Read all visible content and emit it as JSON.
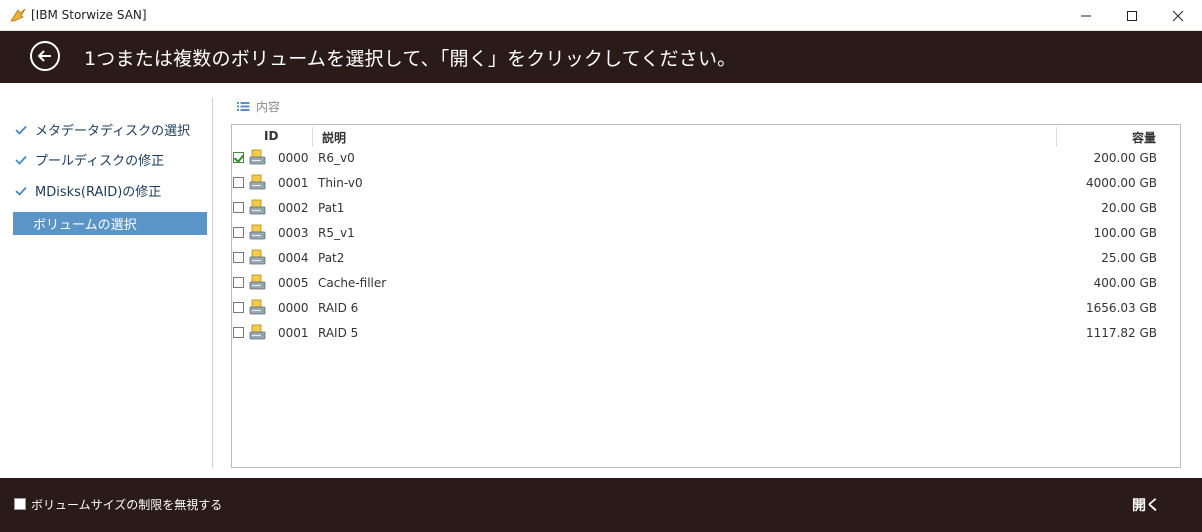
{
  "window": {
    "title": "[IBM Storwize SAN]"
  },
  "header": {
    "title": "1つまたは複数のボリュームを選択して、「開く」をクリックしてください。"
  },
  "sidebar": {
    "steps": [
      {
        "label": "メタデータディスクの選択",
        "done": true
      },
      {
        "label": "プールディスクの修正",
        "done": true
      },
      {
        "label": "MDisks(RAID)の修正",
        "done": true
      },
      {
        "label": "ボリュームの選択",
        "done": false,
        "active": true
      }
    ]
  },
  "content": {
    "section_label": "内容",
    "columns": {
      "id": "ID",
      "description": "説明",
      "capacity": "容量"
    },
    "rows": [
      {
        "checked": true,
        "id": "0000",
        "description": "R6_v0",
        "capacity": "200.00 GB"
      },
      {
        "checked": false,
        "id": "0001",
        "description": "Thin-v0",
        "capacity": "4000.00 GB"
      },
      {
        "checked": false,
        "id": "0002",
        "description": "Pat1",
        "capacity": "20.00 GB"
      },
      {
        "checked": false,
        "id": "0003",
        "description": "R5_v1",
        "capacity": "100.00 GB"
      },
      {
        "checked": false,
        "id": "0004",
        "description": "Pat2",
        "capacity": "25.00 GB"
      },
      {
        "checked": false,
        "id": "0005",
        "description": "Cache-filler",
        "capacity": "400.00 GB"
      },
      {
        "checked": false,
        "id": "0000",
        "description": "RAID 6",
        "capacity": "1656.03 GB"
      },
      {
        "checked": false,
        "id": "0001",
        "description": "RAID 5",
        "capacity": "1117.82 GB"
      }
    ]
  },
  "footer": {
    "ignore_size_label": "ボリュームサイズの制限を無視する",
    "open_label": "開く"
  },
  "colors": {
    "header_bg": "#2a1b18",
    "active_step_bg": "#5b95c8",
    "step_text": "#1c3b5a",
    "check_mark": "#4a88c0"
  }
}
